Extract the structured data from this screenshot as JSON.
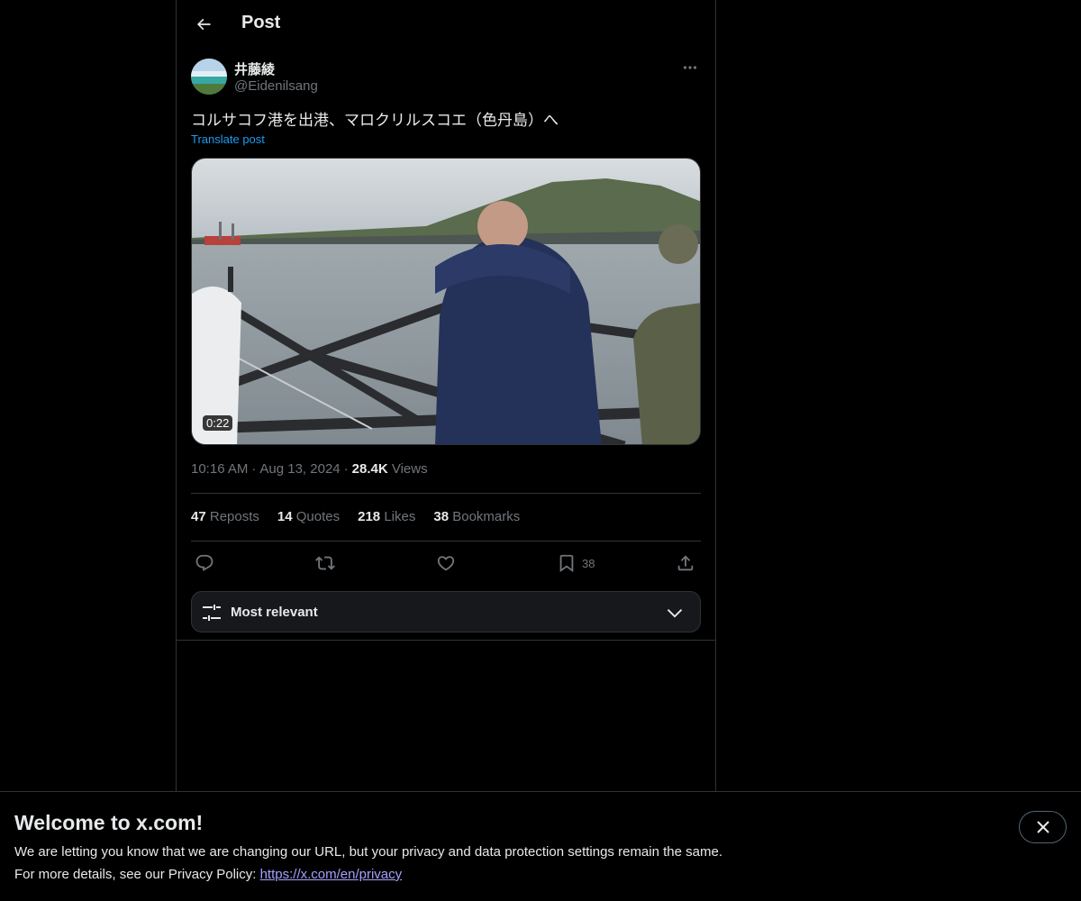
{
  "header": {
    "title": "Post",
    "back_icon": "arrow-left-icon"
  },
  "post": {
    "author_name": "井藤綾",
    "author_handle": "@Eidenilsang",
    "text": "コルサコフ港を出港、マロクリルスコエ（色丹島）へ",
    "translate_label": "Translate post",
    "video_duration": "0:22",
    "time": "10:16 AM",
    "date": "Aug 13, 2024",
    "views_count": "28.4K",
    "views_label": "Views"
  },
  "stats": {
    "reposts_count": "47",
    "reposts_label": "Reposts",
    "quotes_count": "14",
    "quotes_label": "Quotes",
    "likes_count": "218",
    "likes_label": "Likes",
    "bookmarks_count": "38",
    "bookmarks_label": "Bookmarks"
  },
  "actions": {
    "bookmark_count": "38"
  },
  "sort": {
    "label": "Most relevant"
  },
  "banner": {
    "title": "Welcome to x.com!",
    "line1": "We are letting you know that we are changing our URL, but your privacy and data protection settings remain the same.",
    "line2_prefix": "For more details, see our Privacy Policy: ",
    "link": "https://x.com/en/privacy"
  },
  "colors": {
    "accent": "#1d9bf0",
    "link_banner": "#a5a0ff",
    "muted": "#71767b",
    "border": "#2f3336"
  }
}
